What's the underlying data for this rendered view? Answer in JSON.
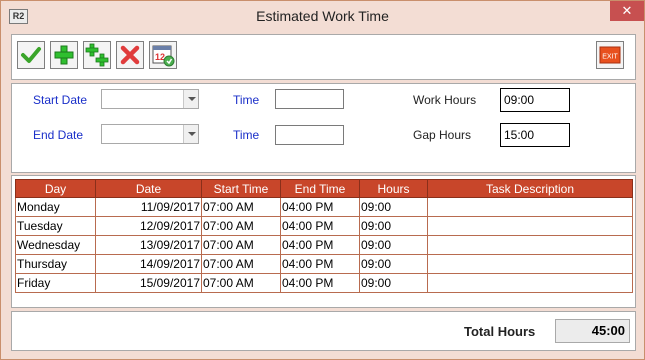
{
  "window": {
    "title": "Estimated Work Time",
    "app_icon_text": "R2",
    "close_glyph": "✕"
  },
  "toolbar": {
    "buttons": [
      {
        "name": "save-button",
        "icon": "checkmark-icon",
        "color": "#3aa52a"
      },
      {
        "name": "add-button",
        "icon": "plus-icon",
        "color": "#2fbf2f"
      },
      {
        "name": "add-multiple-button",
        "icon": "plus-plus-icon",
        "color": "#2fbf2f"
      },
      {
        "name": "delete-button",
        "icon": "x-icon",
        "color": "#e03c3c"
      },
      {
        "name": "calendar-button",
        "icon": "calendar-icon",
        "calendar_text": "12"
      }
    ],
    "exit_label": "EXIT",
    "exit_color": "#e8501e"
  },
  "form": {
    "start_date_label": "Start Date",
    "end_date_label": "End Date",
    "time_label_1": "Time",
    "time_label_2": "Time",
    "start_date_value": "",
    "end_date_value": "",
    "start_time_value": "",
    "end_time_value": "",
    "work_hours_label": "Work Hours",
    "work_hours_value": "09:00",
    "gap_hours_label": "Gap Hours",
    "gap_hours_value": "15:00"
  },
  "grid": {
    "columns": [
      "Day",
      "Date",
      "Start Time",
      "End Time",
      "Hours",
      "Task Description"
    ],
    "rows": [
      [
        "Monday",
        "11/09/2017",
        "07:00 AM",
        "04:00 PM",
        "09:00",
        ""
      ],
      [
        "Tuesday",
        "12/09/2017",
        "07:00 AM",
        "04:00 PM",
        "09:00",
        ""
      ],
      [
        "Wednesday",
        "13/09/2017",
        "07:00 AM",
        "04:00 PM",
        "09:00",
        ""
      ],
      [
        "Thursday",
        "14/09/2017",
        "07:00 AM",
        "04:00 PM",
        "09:00",
        ""
      ],
      [
        "Friday",
        "15/09/2017",
        "07:00 AM",
        "04:00 PM",
        "09:00",
        ""
      ]
    ],
    "header_color": "#c8462a"
  },
  "footer": {
    "total_label": "Total Hours",
    "total_value": "45:00"
  }
}
